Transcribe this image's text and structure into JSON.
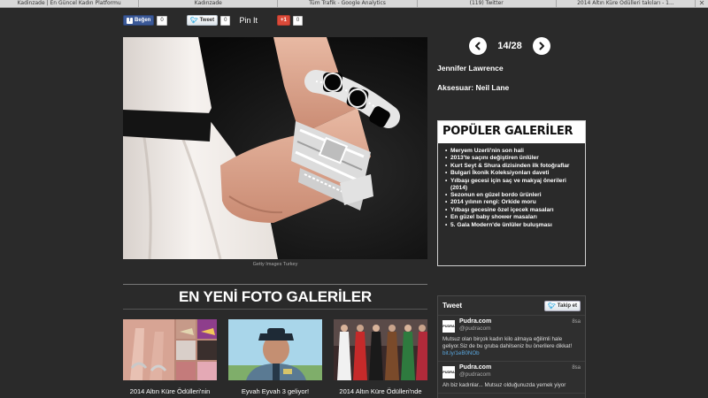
{
  "browser": {
    "tabs": [
      "Kadinzade | En Güncel Kadın Platformu",
      "Kadınzade",
      "Tüm Trafik - Google Analytics",
      "(119) Twitter",
      "2014 Altın Küre Ödülleri takıları - 1..."
    ],
    "close_label": "✕"
  },
  "social": {
    "facebook_label": "Beğen",
    "facebook_count": "0",
    "twitter_label": "Tweet",
    "twitter_count": "0",
    "pinit_label": "Pin It",
    "gplus_label": "+1",
    "gplus_count": "0"
  },
  "photo": {
    "caption": "Getty Images Turkey"
  },
  "pager": {
    "text": "14/28",
    "prev_icon": "chevron-left-icon",
    "next_icon": "chevron-right-icon"
  },
  "info": {
    "person": "Jennifer Lawrence",
    "accessory": "Aksesuar: Neil Lane"
  },
  "popular": {
    "title": "POPÜLER GALERİLER",
    "items": [
      "Meryem Uzerli'nin son hali",
      "2013'te saçını değiştiren ünlüler",
      "Kurt Seyt & Shura dizisinden ilk fotoğraflar",
      "Bulgari İkonik Koleksiyonları daveti",
      "Yılbaşı gecesi için saç ve makyaj önerileri (2014)",
      "Sezonun en güzel bordo ürünleri",
      "2014 yılının rengi: Orkide moru",
      "Yılbaşı gecesine özel içecek masaları",
      "En güzel baby shower masaları",
      "5. Gala Modern'de ünlüler buluşması"
    ]
  },
  "newest": {
    "title": "EN YENİ FOTO GALERİLER",
    "items": [
      "2014 Altın Küre Ödülleri'nin",
      "Eyvah Eyvah 3 geliyor!",
      "2014 Altın Küre Ödülleri'nde"
    ]
  },
  "twitter": {
    "title": "Tweet",
    "follow_label": "Takip et",
    "tweets": [
      {
        "avatar": "PUDRA",
        "name": "Pudra.com",
        "handle": "@pudracom",
        "time": "8sa",
        "text": "Mutsuz olan birçok kadın kilo almaya eğilimli hale geliyor.Siz de bu gruba dahilseniz bu önerilere dikkat!",
        "link": "bit.ly/1eB0NOb"
      },
      {
        "avatar": "PUDRA",
        "name": "Pudra.com",
        "handle": "@pudracom",
        "time": "8sa",
        "text": "Ah biz kadınlar... Mutsuz olduğunuzda yemek yiyor",
        "link": ""
      }
    ]
  },
  "colors": {
    "background": "#2a2a2a",
    "facebook": "#3b5998",
    "gplus": "#db4a39",
    "twitter_link": "#5aa8e0"
  }
}
